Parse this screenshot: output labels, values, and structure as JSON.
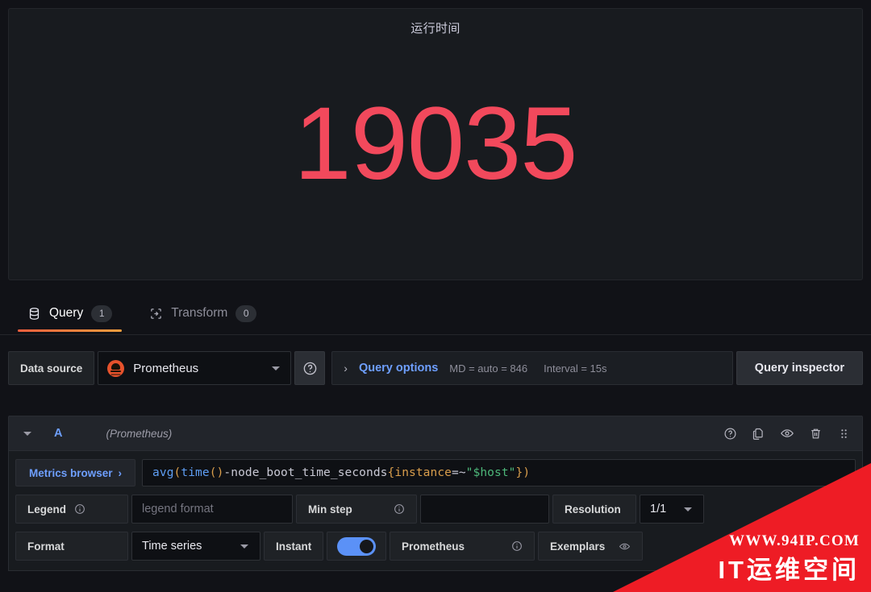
{
  "panel": {
    "title": "运行时间",
    "value": "19035",
    "value_color": "#f2495c"
  },
  "tabs": [
    {
      "label": "Query",
      "badge": "1",
      "icon": "database-icon",
      "active": true
    },
    {
      "label": "Transform",
      "badge": "0",
      "icon": "transform-icon",
      "active": false
    }
  ],
  "datasource_row": {
    "label": "Data source",
    "selected": "Prometheus",
    "logo_icon": "prometheus-logo-icon",
    "help_icon": "help-circle-icon",
    "caret": "›",
    "query_options_label": "Query options",
    "max_data_points": "MD = auto = 846",
    "interval": "Interval = 15s",
    "query_inspector_label": "Query inspector"
  },
  "query": {
    "ref_id": "A",
    "datasource_note": "(Prometheus)",
    "actions": [
      {
        "name": "query-help-icon",
        "title": "Help"
      },
      {
        "name": "duplicate-query-icon",
        "title": "Duplicate"
      },
      {
        "name": "hide-response-eye-icon",
        "title": "Hide response"
      },
      {
        "name": "remove-query-trash-icon",
        "title": "Remove"
      },
      {
        "name": "drag-handle-icon",
        "title": "Drag"
      }
    ],
    "metrics_browser_label": "Metrics browser",
    "metrics_browser_caret": "›",
    "expression": {
      "full": "avg(time() - node_boot_time_seconds{instance=~\"$host\"})",
      "tokens": {
        "fn_avg": "avg",
        "open1": "(",
        "fn_time": "time",
        "open2": "(",
        "close2": ")",
        "minus": " - ",
        "metric": "node_boot_time_seconds",
        "brace_open": "{",
        "label": "instance",
        "matcher": "=~",
        "value": "\"$host\"",
        "brace_close": "}",
        "close1": ")"
      }
    },
    "legend": {
      "label": "Legend",
      "placeholder": "legend format",
      "value": ""
    },
    "min_step": {
      "label": "Min step",
      "value": "",
      "placeholder": ""
    },
    "resolution": {
      "label": "Resolution",
      "value": "1/1"
    },
    "format": {
      "label": "Format",
      "value": "Time series"
    },
    "instant": {
      "label": "Instant",
      "state": "on"
    },
    "prometheus_type": {
      "label": "Prometheus"
    },
    "exemplars": {
      "label": "Exemplars",
      "icon": "eye-icon"
    }
  },
  "watermark": {
    "url": "WWW.94IP.COM",
    "brand": "IT运维空间",
    "color": "#ee1c25"
  }
}
